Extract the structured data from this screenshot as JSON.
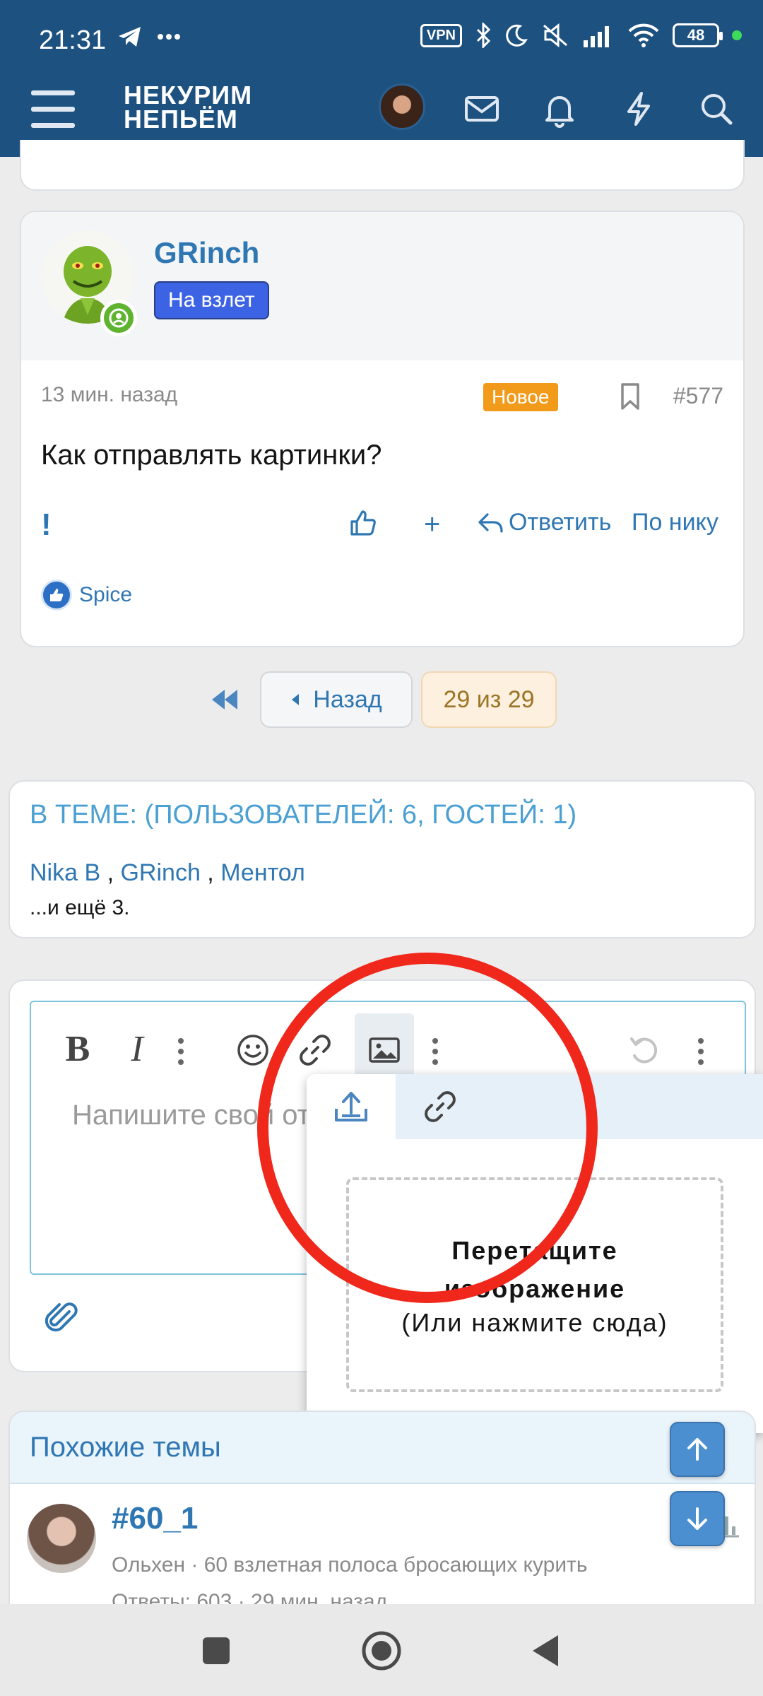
{
  "status": {
    "time": "21:31",
    "vpn": "VPN",
    "battery": "48"
  },
  "header": {
    "logo_line1": "НЕКУРИМ",
    "logo_line2": "НЕПЬЁМ"
  },
  "post": {
    "username": "GRinch",
    "rank": "На взлет",
    "time": "13 мин. назад",
    "badge": "Новое",
    "number": "#577",
    "text": "Как отправлять картинки?",
    "exclaim": "!",
    "add": "+",
    "reply": "Ответить",
    "by_nick": "По нику",
    "liked_by": "Spice"
  },
  "pagination": {
    "back": "Назад",
    "count": "29 из 29"
  },
  "online": {
    "title": "В ТЕМЕ: (ПОЛЬЗОВАТЕЛЕЙ: 6, ГОСТЕЙ: 1)",
    "users": [
      "Nika B",
      "GRinch",
      "Ментол"
    ],
    "separator": " , ",
    "more": "...и ещё 3."
  },
  "editor": {
    "placeholder": "Напишите свой ответ..."
  },
  "image_popup": {
    "drop_title": "Перетащите изображение",
    "drop_sub": "(Или нажмите сюда)"
  },
  "similar": {
    "title": "Похожие темы",
    "topic_title": "#60_1",
    "topic_meta": "Ольхен · 60 взлетная полоса бросающих курить",
    "topic_replies": "Ответы: 603 · 29 мин. назад"
  },
  "colors": {
    "header": "#1d5180",
    "link": "#2f77b3",
    "accent_red": "#f0271b",
    "new_badge": "#f29a1a",
    "rank": "#3d63e5"
  }
}
